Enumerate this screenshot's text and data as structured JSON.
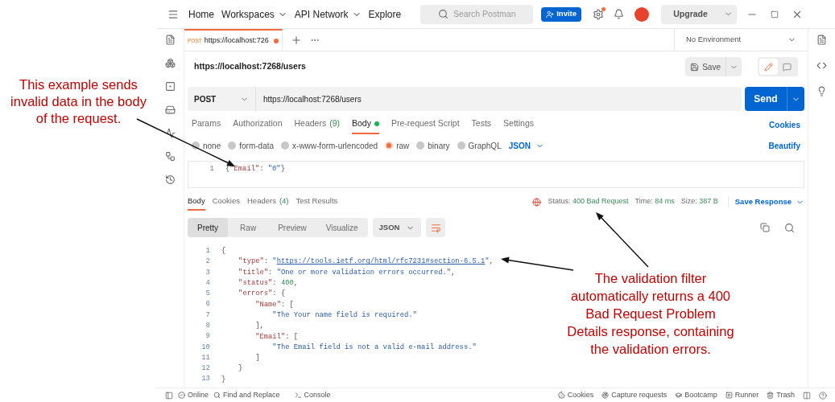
{
  "annotations": [
    {
      "lines": [
        "This example sends",
        "invalid data in the body",
        "of the request."
      ]
    },
    {
      "lines": [
        "The validation filter",
        "automatically returns a 400",
        "Bad Request Problem",
        "Details response, containing",
        "the validation errors."
      ]
    }
  ],
  "top_nav": {
    "items": [
      {
        "label": "Home",
        "dropdown": false
      },
      {
        "label": "Workspaces",
        "dropdown": true
      },
      {
        "label": "API Network",
        "dropdown": true
      },
      {
        "label": "Explore",
        "dropdown": false
      }
    ],
    "search": {
      "placeholder": "Search Postman"
    },
    "invite": "Invite",
    "upgrade": "Upgrade"
  },
  "tabs": [
    {
      "method": "POST",
      "label": "https://localhost:726",
      "unsaved": true,
      "selected": true
    }
  ],
  "environment": "No Environment",
  "request": {
    "title": "https://localhost:7268/users",
    "save": "Save",
    "method": "POST",
    "url": "https://localhost:7268/users",
    "send": "Send",
    "tabs": [
      {
        "label": "Params",
        "selected": false
      },
      {
        "label": "Authorization",
        "selected": false
      },
      {
        "label": "Headers",
        "count": "(9)",
        "selected": false
      },
      {
        "label": "Body",
        "dot": true,
        "selected": true
      },
      {
        "label": "Pre-request Script",
        "selected": false
      },
      {
        "label": "Tests",
        "selected": false
      },
      {
        "label": "Settings",
        "selected": false
      }
    ],
    "cookies": "Cookies",
    "body_types": [
      {
        "label": "none",
        "selected": false
      },
      {
        "label": "form-data",
        "selected": false
      },
      {
        "label": "x-www-form-urlencoded",
        "selected": false
      },
      {
        "label": "raw",
        "selected": true
      },
      {
        "label": "binary",
        "selected": false
      },
      {
        "label": "GraphQL",
        "selected": false
      }
    ],
    "format": "JSON",
    "beautify": "Beautify",
    "body_lines": [
      {
        "number": "1",
        "tokens": [
          {
            "text": "{",
            "kind": "punct"
          },
          {
            "text": "\"Email\"",
            "kind": "key"
          },
          {
            "text": ": ",
            "kind": "punct"
          },
          {
            "text": "\"0\"",
            "kind": "string"
          },
          {
            "text": "}",
            "kind": "punct"
          }
        ]
      }
    ]
  },
  "response": {
    "tabs": [
      {
        "label": "Body",
        "selected": true
      },
      {
        "label": "Cookies",
        "selected": false
      },
      {
        "label": "Headers",
        "count": "(4)",
        "selected": false
      },
      {
        "label": "Test Results",
        "selected": false
      }
    ],
    "status": [
      {
        "label": "Status:",
        "value": "400 Bad Request"
      },
      {
        "label": "Time:",
        "value": "84 ms"
      },
      {
        "label": "Size:",
        "value": "387 B"
      }
    ],
    "save_response": "Save Response",
    "views": [
      {
        "label": "Pretty",
        "selected": true
      },
      {
        "label": "Raw",
        "selected": false
      },
      {
        "label": "Preview",
        "selected": false
      },
      {
        "label": "Visualize",
        "selected": false
      }
    ],
    "format": "JSON",
    "lines": [
      {
        "number": "1",
        "tokens": [
          {
            "text": "{",
            "kind": "punct"
          }
        ]
      },
      {
        "number": "2",
        "tokens": [
          {
            "text": "    \"type\"",
            "kind": "key"
          },
          {
            "text": ": ",
            "kind": "punct"
          },
          {
            "text": "\"",
            "kind": "string"
          },
          {
            "text": "https://tools.ietf.org/html/rfc7231#section-6.5.1",
            "kind": "link"
          },
          {
            "text": "\"",
            "kind": "string"
          },
          {
            "text": ",",
            "kind": "punct"
          }
        ]
      },
      {
        "number": "3",
        "tokens": [
          {
            "text": "    \"title\"",
            "kind": "key"
          },
          {
            "text": ": ",
            "kind": "punct"
          },
          {
            "text": "\"One or more validation errors occurred.\"",
            "kind": "string"
          },
          {
            "text": ",",
            "kind": "punct"
          }
        ]
      },
      {
        "number": "4",
        "tokens": [
          {
            "text": "    \"status\"",
            "kind": "key"
          },
          {
            "text": ": ",
            "kind": "punct"
          },
          {
            "text": "400",
            "kind": "number"
          },
          {
            "text": ",",
            "kind": "punct"
          }
        ]
      },
      {
        "number": "5",
        "tokens": [
          {
            "text": "    \"errors\"",
            "kind": "key"
          },
          {
            "text": ": {",
            "kind": "punct"
          }
        ]
      },
      {
        "number": "6",
        "tokens": [
          {
            "text": "        \"Name\"",
            "kind": "key"
          },
          {
            "text": ": [",
            "kind": "punct"
          }
        ]
      },
      {
        "number": "7",
        "tokens": [
          {
            "text": "            \"The Your name field is required.\"",
            "kind": "string"
          }
        ]
      },
      {
        "number": "8",
        "tokens": [
          {
            "text": "        ],",
            "kind": "punct"
          }
        ]
      },
      {
        "number": "9",
        "tokens": [
          {
            "text": "        \"Email\"",
            "kind": "key"
          },
          {
            "text": ": [",
            "kind": "punct"
          }
        ]
      },
      {
        "number": "10",
        "tokens": [
          {
            "text": "            \"The Email field is not a valid e-mail address.\"",
            "kind": "string"
          }
        ]
      },
      {
        "number": "11",
        "tokens": [
          {
            "text": "        ]",
            "kind": "punct"
          }
        ]
      },
      {
        "number": "12",
        "tokens": [
          {
            "text": "    }",
            "kind": "punct"
          }
        ]
      },
      {
        "number": "13",
        "tokens": [
          {
            "text": "}",
            "kind": "punct"
          }
        ]
      }
    ]
  },
  "status_bar": {
    "left": [
      "Online",
      "Find and Replace",
      "Console"
    ],
    "right": [
      "Cookies",
      "Capture requests",
      "Bootcamp",
      "Runner",
      "Trash"
    ]
  }
}
